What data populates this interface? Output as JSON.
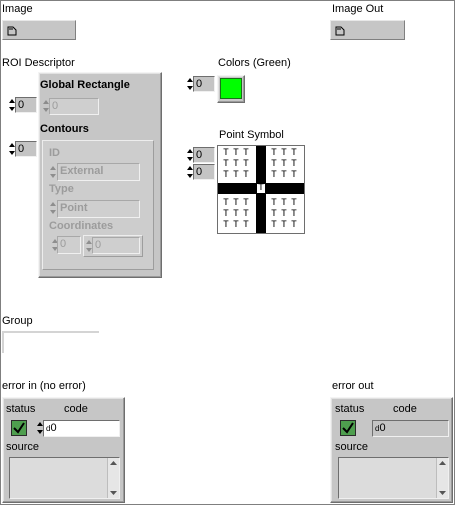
{
  "image": {
    "label": "Image"
  },
  "image_out": {
    "label": "Image Out"
  },
  "roi": {
    "label": "ROI Descriptor",
    "index_value": "0",
    "global_rectangle": {
      "label": "Global Rectangle",
      "index_value": "0",
      "value": "0"
    },
    "contours": {
      "label": "Contours",
      "index_value": "0",
      "id_label": "ID",
      "id_value": "External",
      "type_label": "Type",
      "type_value": "Point",
      "coordinates_label": "Coordinates",
      "coord_index_value": "0",
      "coord_value": "0"
    }
  },
  "colors": {
    "label": "Colors (Green)",
    "index_value": "0",
    "swatch_color": "#00ff00"
  },
  "point_symbol": {
    "label": "Point Symbol",
    "index_row": "0",
    "index_col": "0",
    "cell_glyph": "T"
  },
  "group": {
    "label": "Group"
  },
  "error_in": {
    "label": "error in (no error)",
    "status_label": "status",
    "code_label": "code",
    "code_value": "0",
    "source_label": "source"
  },
  "error_out": {
    "label": "error out",
    "status_label": "status",
    "code_label": "code",
    "code_value": "0",
    "source_label": "source"
  }
}
